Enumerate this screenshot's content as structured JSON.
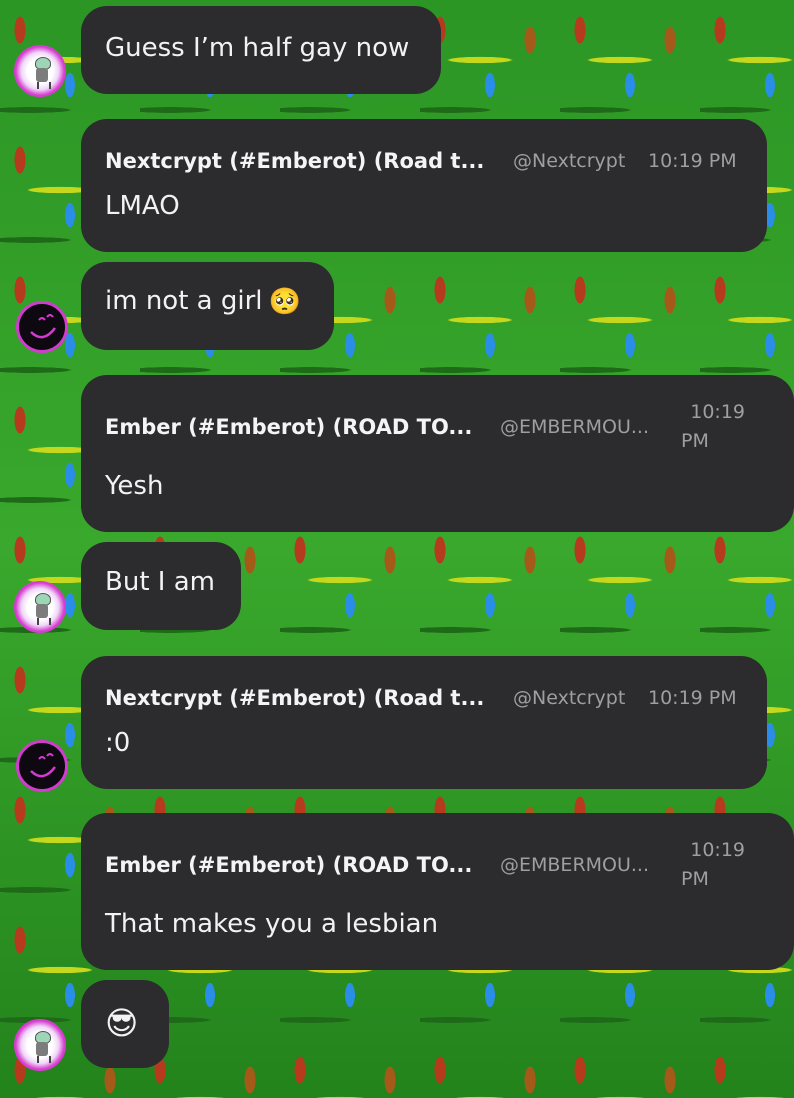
{
  "messages": [
    {
      "type": "plain",
      "text": "Guess I’m half gay now"
    },
    {
      "type": "reply",
      "author": "Nextcrypt (#Emberot) (Road t...",
      "handle": "@Nextcrypt",
      "time": "10:19 PM",
      "text": "LMAO"
    },
    {
      "type": "plain",
      "text": "im not a girl",
      "emoji": "🥺"
    },
    {
      "type": "reply",
      "author": "Ember (#Emberot) (ROAD TO...",
      "handle": "@EMBERMOU...",
      "time_line1": "10:19",
      "time_line2": "PM",
      "text": "Yesh"
    },
    {
      "type": "plain",
      "text": "But I am"
    },
    {
      "type": "reply",
      "author": "Nextcrypt (#Emberot) (Road t...",
      "handle": "@Nextcrypt",
      "time": "10:19 PM",
      "text": ":0"
    },
    {
      "type": "reply",
      "author": "Ember (#Emberot) (ROAD TO...",
      "handle": "@EMBERMOU...",
      "time_line1": "10:19",
      "time_line2": "PM",
      "text": "That makes you a lesbian"
    },
    {
      "type": "emoji",
      "emoji": "😎"
    }
  ],
  "avatars": [
    "alien-avatar",
    "smiley-avatar",
    "alien-avatar",
    "smiley-avatar",
    "alien-avatar"
  ],
  "colors": {
    "bubble": "#2c2b2d",
    "avatar_ring": "#d83dd2",
    "meta_text": "#9e9ea3"
  }
}
